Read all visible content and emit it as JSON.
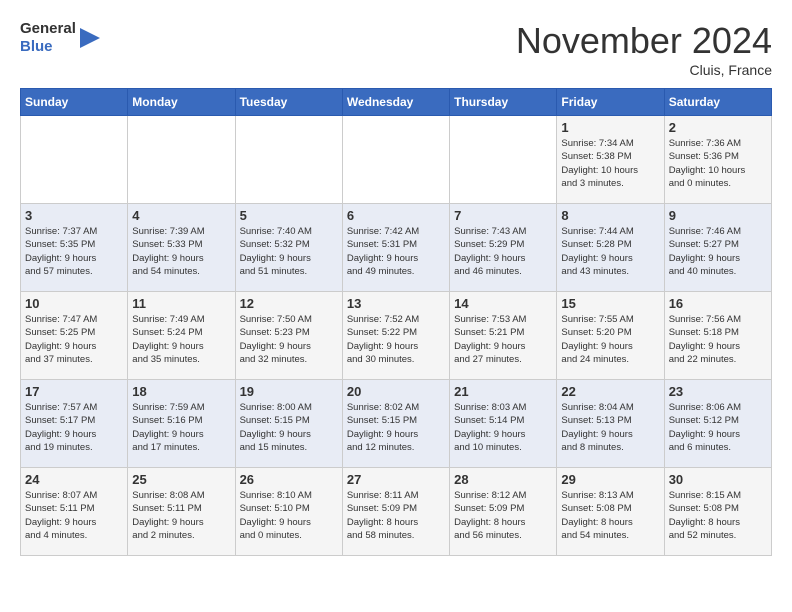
{
  "header": {
    "logo_line1": "General",
    "logo_line2": "Blue",
    "month": "November 2024",
    "location": "Cluis, France"
  },
  "days_of_week": [
    "Sunday",
    "Monday",
    "Tuesday",
    "Wednesday",
    "Thursday",
    "Friday",
    "Saturday"
  ],
  "weeks": [
    [
      {
        "day": "",
        "info": ""
      },
      {
        "day": "",
        "info": ""
      },
      {
        "day": "",
        "info": ""
      },
      {
        "day": "",
        "info": ""
      },
      {
        "day": "",
        "info": ""
      },
      {
        "day": "1",
        "info": "Sunrise: 7:34 AM\nSunset: 5:38 PM\nDaylight: 10 hours\nand 3 minutes."
      },
      {
        "day": "2",
        "info": "Sunrise: 7:36 AM\nSunset: 5:36 PM\nDaylight: 10 hours\nand 0 minutes."
      }
    ],
    [
      {
        "day": "3",
        "info": "Sunrise: 7:37 AM\nSunset: 5:35 PM\nDaylight: 9 hours\nand 57 minutes."
      },
      {
        "day": "4",
        "info": "Sunrise: 7:39 AM\nSunset: 5:33 PM\nDaylight: 9 hours\nand 54 minutes."
      },
      {
        "day": "5",
        "info": "Sunrise: 7:40 AM\nSunset: 5:32 PM\nDaylight: 9 hours\nand 51 minutes."
      },
      {
        "day": "6",
        "info": "Sunrise: 7:42 AM\nSunset: 5:31 PM\nDaylight: 9 hours\nand 49 minutes."
      },
      {
        "day": "7",
        "info": "Sunrise: 7:43 AM\nSunset: 5:29 PM\nDaylight: 9 hours\nand 46 minutes."
      },
      {
        "day": "8",
        "info": "Sunrise: 7:44 AM\nSunset: 5:28 PM\nDaylight: 9 hours\nand 43 minutes."
      },
      {
        "day": "9",
        "info": "Sunrise: 7:46 AM\nSunset: 5:27 PM\nDaylight: 9 hours\nand 40 minutes."
      }
    ],
    [
      {
        "day": "10",
        "info": "Sunrise: 7:47 AM\nSunset: 5:25 PM\nDaylight: 9 hours\nand 37 minutes."
      },
      {
        "day": "11",
        "info": "Sunrise: 7:49 AM\nSunset: 5:24 PM\nDaylight: 9 hours\nand 35 minutes."
      },
      {
        "day": "12",
        "info": "Sunrise: 7:50 AM\nSunset: 5:23 PM\nDaylight: 9 hours\nand 32 minutes."
      },
      {
        "day": "13",
        "info": "Sunrise: 7:52 AM\nSunset: 5:22 PM\nDaylight: 9 hours\nand 30 minutes."
      },
      {
        "day": "14",
        "info": "Sunrise: 7:53 AM\nSunset: 5:21 PM\nDaylight: 9 hours\nand 27 minutes."
      },
      {
        "day": "15",
        "info": "Sunrise: 7:55 AM\nSunset: 5:20 PM\nDaylight: 9 hours\nand 24 minutes."
      },
      {
        "day": "16",
        "info": "Sunrise: 7:56 AM\nSunset: 5:18 PM\nDaylight: 9 hours\nand 22 minutes."
      }
    ],
    [
      {
        "day": "17",
        "info": "Sunrise: 7:57 AM\nSunset: 5:17 PM\nDaylight: 9 hours\nand 19 minutes."
      },
      {
        "day": "18",
        "info": "Sunrise: 7:59 AM\nSunset: 5:16 PM\nDaylight: 9 hours\nand 17 minutes."
      },
      {
        "day": "19",
        "info": "Sunrise: 8:00 AM\nSunset: 5:15 PM\nDaylight: 9 hours\nand 15 minutes."
      },
      {
        "day": "20",
        "info": "Sunrise: 8:02 AM\nSunset: 5:15 PM\nDaylight: 9 hours\nand 12 minutes."
      },
      {
        "day": "21",
        "info": "Sunrise: 8:03 AM\nSunset: 5:14 PM\nDaylight: 9 hours\nand 10 minutes."
      },
      {
        "day": "22",
        "info": "Sunrise: 8:04 AM\nSunset: 5:13 PM\nDaylight: 9 hours\nand 8 minutes."
      },
      {
        "day": "23",
        "info": "Sunrise: 8:06 AM\nSunset: 5:12 PM\nDaylight: 9 hours\nand 6 minutes."
      }
    ],
    [
      {
        "day": "24",
        "info": "Sunrise: 8:07 AM\nSunset: 5:11 PM\nDaylight: 9 hours\nand 4 minutes."
      },
      {
        "day": "25",
        "info": "Sunrise: 8:08 AM\nSunset: 5:11 PM\nDaylight: 9 hours\nand 2 minutes."
      },
      {
        "day": "26",
        "info": "Sunrise: 8:10 AM\nSunset: 5:10 PM\nDaylight: 9 hours\nand 0 minutes."
      },
      {
        "day": "27",
        "info": "Sunrise: 8:11 AM\nSunset: 5:09 PM\nDaylight: 8 hours\nand 58 minutes."
      },
      {
        "day": "28",
        "info": "Sunrise: 8:12 AM\nSunset: 5:09 PM\nDaylight: 8 hours\nand 56 minutes."
      },
      {
        "day": "29",
        "info": "Sunrise: 8:13 AM\nSunset: 5:08 PM\nDaylight: 8 hours\nand 54 minutes."
      },
      {
        "day": "30",
        "info": "Sunrise: 8:15 AM\nSunset: 5:08 PM\nDaylight: 8 hours\nand 52 minutes."
      }
    ]
  ]
}
